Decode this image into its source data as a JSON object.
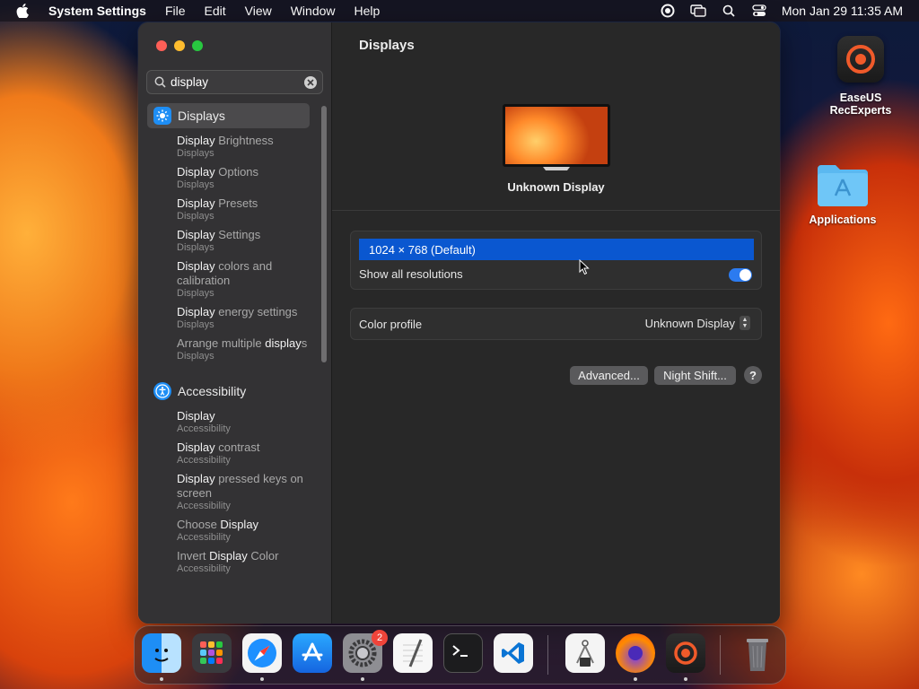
{
  "menubar": {
    "app_name": "System Settings",
    "menus": [
      "File",
      "Edit",
      "View",
      "Window",
      "Help"
    ],
    "clock": "Mon Jan 29  11:35 AM"
  },
  "desktop": {
    "easeus_label": "EaseUS\nRecExperts",
    "applications_label": "Applications"
  },
  "sidebar": {
    "search_value": "display",
    "categories": [
      {
        "label": "Displays",
        "results": [
          {
            "hl": "Display",
            "rest": " Brightness",
            "sub": "Displays"
          },
          {
            "hl": "Display",
            "rest": " Options",
            "sub": "Displays"
          },
          {
            "hl": "Display",
            "rest": " Presets",
            "sub": "Displays"
          },
          {
            "hl": "Display",
            "rest": " Settings",
            "sub": "Displays"
          },
          {
            "hl": "Display",
            "rest": " colors and calibration",
            "sub": "Displays"
          },
          {
            "hl": "Display",
            "rest": " energy settings",
            "sub": "Displays"
          },
          {
            "pre": "Arrange multiple ",
            "hl": "display",
            "rest": "s",
            "sub": "Displays"
          }
        ]
      },
      {
        "label": "Accessibility",
        "results": [
          {
            "hl": "Display",
            "rest": "",
            "sub": "Accessibility"
          },
          {
            "hl": "Display",
            "rest": " contrast",
            "sub": "Accessibility"
          },
          {
            "hl": "Display",
            "rest": " pressed keys on screen",
            "sub": "Accessibility"
          },
          {
            "pre": "Choose ",
            "hl": "Display",
            "rest": "",
            "sub": "Accessibility"
          },
          {
            "pre": "Invert ",
            "hl": "Display",
            "rest": " Color",
            "sub": "Accessibility"
          }
        ]
      }
    ]
  },
  "main": {
    "title": "Displays",
    "display_name": "Unknown Display",
    "resolution": "1024 × 768 (Default)",
    "show_all_label": "Show all resolutions",
    "color_profile_label": "Color profile",
    "color_profile_value": "Unknown Display",
    "advanced_label": "Advanced...",
    "night_shift_label": "Night Shift...",
    "help_label": "?"
  },
  "dock": {
    "settings_badge": "2"
  },
  "colors": {
    "selection_blue": "#0a57d0",
    "toggle_blue": "#2c7bf0",
    "badge_red": "#f0443a"
  }
}
